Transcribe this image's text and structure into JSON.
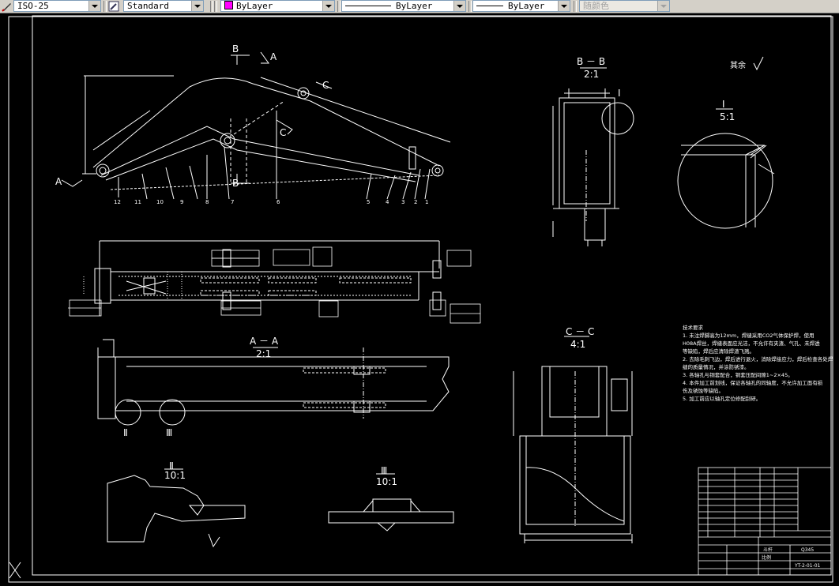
{
  "toolbar": {
    "dimstyle": "ISO-25",
    "textstyle": "Standard",
    "layer": "ByLayer",
    "linetype": "ByLayer",
    "lineweight": "ByLayer",
    "plotstyle": "随颜色",
    "layer_color": "#ff00ff"
  },
  "drawing": {
    "view_main": {
      "B": "B",
      "A": "A",
      "C": "C",
      "parts": [
        "12",
        "11",
        "10",
        "9",
        "8",
        "7",
        "6",
        "5",
        "4",
        "3",
        "2",
        "1"
      ]
    },
    "section_bb": {
      "title": "B － B",
      "scale": "2:1",
      "detail_ref": "I"
    },
    "detail_i": {
      "title": "I",
      "scale": "5:1"
    },
    "section_aa": {
      "title": "A － A",
      "scale": "2:1",
      "callouts": [
        "Ⅱ",
        "Ⅲ"
      ]
    },
    "section_cc": {
      "title": "C － C",
      "scale": "4:1"
    },
    "detail_ii": {
      "title": "Ⅱ",
      "scale": "10:1"
    },
    "detail_iii": {
      "title": "Ⅲ",
      "scale": "10:1"
    },
    "roughness_note": "其余",
    "tech_req": {
      "heading": "技术要求",
      "lines": [
        "1. 未注焊脚高为12mm，焊缝采用CO2气体保护焊，使用",
        "H08A焊丝，焊缝表面应光洁，不允许有夹渣、气孔、未焊透",
        "等缺陷，焊后应清除焊渣飞溅。",
        "2. 去除毛刺飞边，焊后进行退火，消除焊接应力，焊后检查各处焊",
        "缝的质量情况，并涂防锈漆。",
        "3. 各轴孔与铜套配合，铜套压配间隙1~2×45。",
        "4. 本件加工前划线，保证各轴孔的同轴度，不允许加工面有损",
        "伤及锈蚀等缺陷。",
        "5. 加工前应以轴孔定位修配刮研。"
      ]
    },
    "title_block": {
      "drawing_no": "YT-2-01-01",
      "name": "斗杆",
      "material": "Q345",
      "scale_label": "比例"
    }
  }
}
